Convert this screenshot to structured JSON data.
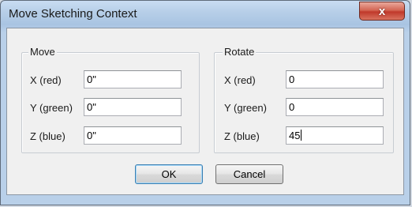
{
  "window": {
    "title": "Move Sketching Context",
    "close_glyph": "x"
  },
  "move": {
    "legend": "Move",
    "x_label": "X (red)",
    "x_value": "0\"",
    "y_label": "Y (green)",
    "y_value": "0\"",
    "z_label": "Z (blue)",
    "z_value": "0\""
  },
  "rotate": {
    "legend": "Rotate",
    "x_label": "X (red)",
    "x_value": "0",
    "y_label": "Y (green)",
    "y_value": "0",
    "z_label": "Z (blue)",
    "z_value": "45"
  },
  "buttons": {
    "ok_label": "OK",
    "cancel_label": "Cancel"
  },
  "colors": {
    "close_button": "#c0392b",
    "default_button_border": "#3c7fb1"
  }
}
